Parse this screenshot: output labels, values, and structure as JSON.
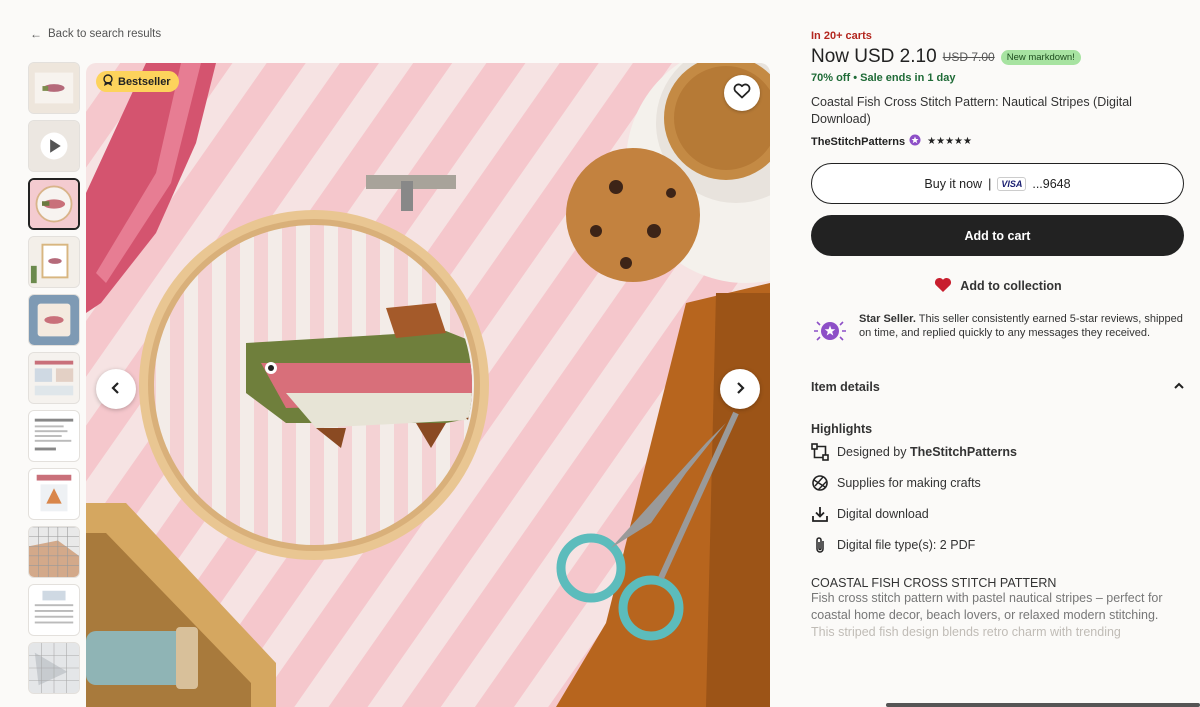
{
  "nav": {
    "back_label": "Back to search results"
  },
  "gallery": {
    "badge_label": "Bestseller",
    "thumbnails": [
      "fish-pattern-hands",
      "video-preview",
      "fish-hoop",
      "framed-fish",
      "fish-pillow",
      "pattern-info",
      "pattern-contents",
      "example-fox",
      "pattern-chart",
      "pattern-key",
      "pattern-grid"
    ],
    "selected_index": 2
  },
  "product": {
    "in_carts": "In 20+ carts",
    "price_now": "Now USD 2.10",
    "price_old": "USD 7.00",
    "markdown_badge": "New markdown!",
    "discount": "70% off",
    "sale_ends": "Sale ends in 1 day",
    "title": "Coastal Fish Cross Stitch Pattern: Nautical Stripes (Digital Download)",
    "shop_name": "TheStitchPatterns",
    "rating_stars": "★★★★★",
    "buy_now_label": "Buy it now",
    "card_brand": "VISA",
    "card_last4": "...9648",
    "add_to_cart_label": "Add to cart",
    "add_to_collection_label": "Add to collection"
  },
  "star_seller": {
    "title": "Star Seller.",
    "text": "This seller consistently earned 5-star reviews, shipped on time, and replied quickly to any messages they received."
  },
  "item_details": {
    "heading": "Item details",
    "highlights_heading": "Highlights",
    "designed_by_prefix": "Designed by",
    "designed_by_shop": "TheStitchPatterns",
    "supplies": "Supplies for making crafts",
    "digital_download": "Digital download",
    "file_types": "Digital file type(s): 2 PDF",
    "desc_heading": "COASTAL FISH CROSS STITCH PATTERN",
    "desc_line": "Fish cross stitch pattern with pastel nautical stripes – perfect for coastal home decor, beach lovers, or relaxed modern stitching.",
    "desc_fade": "This striped fish design blends retro charm with trending"
  }
}
